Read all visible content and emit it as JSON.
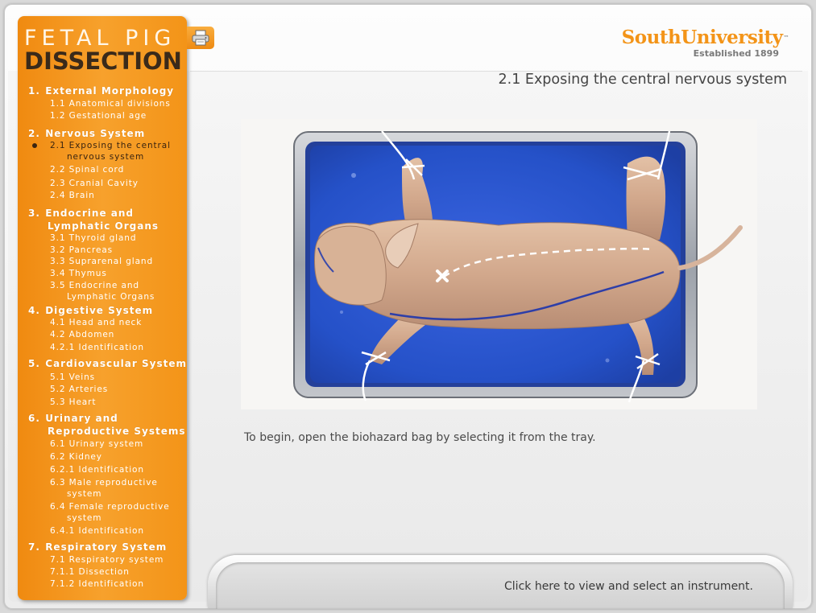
{
  "app": {
    "title_line1": "FETAL PIG",
    "title_line2": "DISSECTION",
    "brand": "SouthUniversity",
    "brand_tm": "™",
    "brand_tagline": "Established 1899"
  },
  "toc": {
    "sections": [
      {
        "num": "1.",
        "label": "External Morphology",
        "cont": "",
        "items": [
          {
            "num": "1.1",
            "label": "Anatomical divisions",
            "cont": ""
          },
          {
            "num": "1.2",
            "label": "Gestational age",
            "cont": ""
          }
        ]
      },
      {
        "num": "2.",
        "label": "Nervous System",
        "cont": "",
        "items": [
          {
            "num": "2.1",
            "label": "Exposing the central",
            "cont": "nervous system",
            "active": true
          },
          {
            "num": "2.2",
            "label": "Spinal cord",
            "cont": ""
          },
          {
            "num": "2.3",
            "label": "Cranial Cavity",
            "cont": ""
          },
          {
            "num": "2.4",
            "label": "Brain",
            "cont": ""
          }
        ]
      },
      {
        "num": "3.",
        "label": "Endocrine and",
        "cont": "Lymphatic Organs",
        "items": [
          {
            "num": "3.1",
            "label": "Thyroid gland",
            "cont": ""
          },
          {
            "num": "3.2",
            "label": "Pancreas",
            "cont": ""
          },
          {
            "num": "3.3",
            "label": "Suprarenal gland",
            "cont": ""
          },
          {
            "num": "3.4",
            "label": "Thymus",
            "cont": ""
          },
          {
            "num": "3.5",
            "label": "Endocrine and",
            "cont": "Lymphatic Organs"
          }
        ]
      },
      {
        "num": "4.",
        "label": "Digestive System",
        "cont": "",
        "items": [
          {
            "num": "4.1",
            "label": "Head and neck",
            "cont": ""
          },
          {
            "num": "4.2",
            "label": "Abdomen",
            "cont": ""
          },
          {
            "num": "4.2.1",
            "label": "Identification",
            "cont": ""
          }
        ]
      },
      {
        "num": "5.",
        "label": "Cardiovascular System",
        "cont": "",
        "items": [
          {
            "num": "5.1",
            "label": "Veins",
            "cont": ""
          },
          {
            "num": "5.2",
            "label": "Arteries",
            "cont": ""
          },
          {
            "num": "5.3",
            "label": "Heart",
            "cont": ""
          }
        ]
      },
      {
        "num": "6.",
        "label": "Urinary and",
        "cont": "Reproductive Systems",
        "items": [
          {
            "num": "6.1",
            "label": "Urinary system",
            "cont": ""
          },
          {
            "num": "6.2",
            "label": "Kidney",
            "cont": ""
          },
          {
            "num": "6.2.1",
            "label": "Identification",
            "cont": ""
          },
          {
            "num": "6.3",
            "label": "Male reproductive",
            "cont": "system"
          },
          {
            "num": "6.4",
            "label": "Female reproductive",
            "cont": "system"
          },
          {
            "num": "6.4.1",
            "label": "Identification",
            "cont": ""
          }
        ]
      },
      {
        "num": "7.",
        "label": "Respiratory System",
        "cont": "",
        "items": [
          {
            "num": "7.1",
            "label": "Respiratory system",
            "cont": ""
          },
          {
            "num": "7.1.1",
            "label": "Dissection",
            "cont": ""
          },
          {
            "num": "7.1.2",
            "label": "Identification",
            "cont": ""
          }
        ]
      }
    ]
  },
  "main": {
    "page_title": "2.1 Exposing the central nervous system",
    "instructions": "To begin, open the biohazard bag by selecting it from the tray.",
    "tray_label": "Click here to view and select an instrument."
  },
  "icons": {
    "print": "printer-icon",
    "target": "x-marker-icon"
  },
  "colors": {
    "sidebar": "#f39418",
    "brand": "#f39418",
    "tray": "#2b55c9"
  }
}
